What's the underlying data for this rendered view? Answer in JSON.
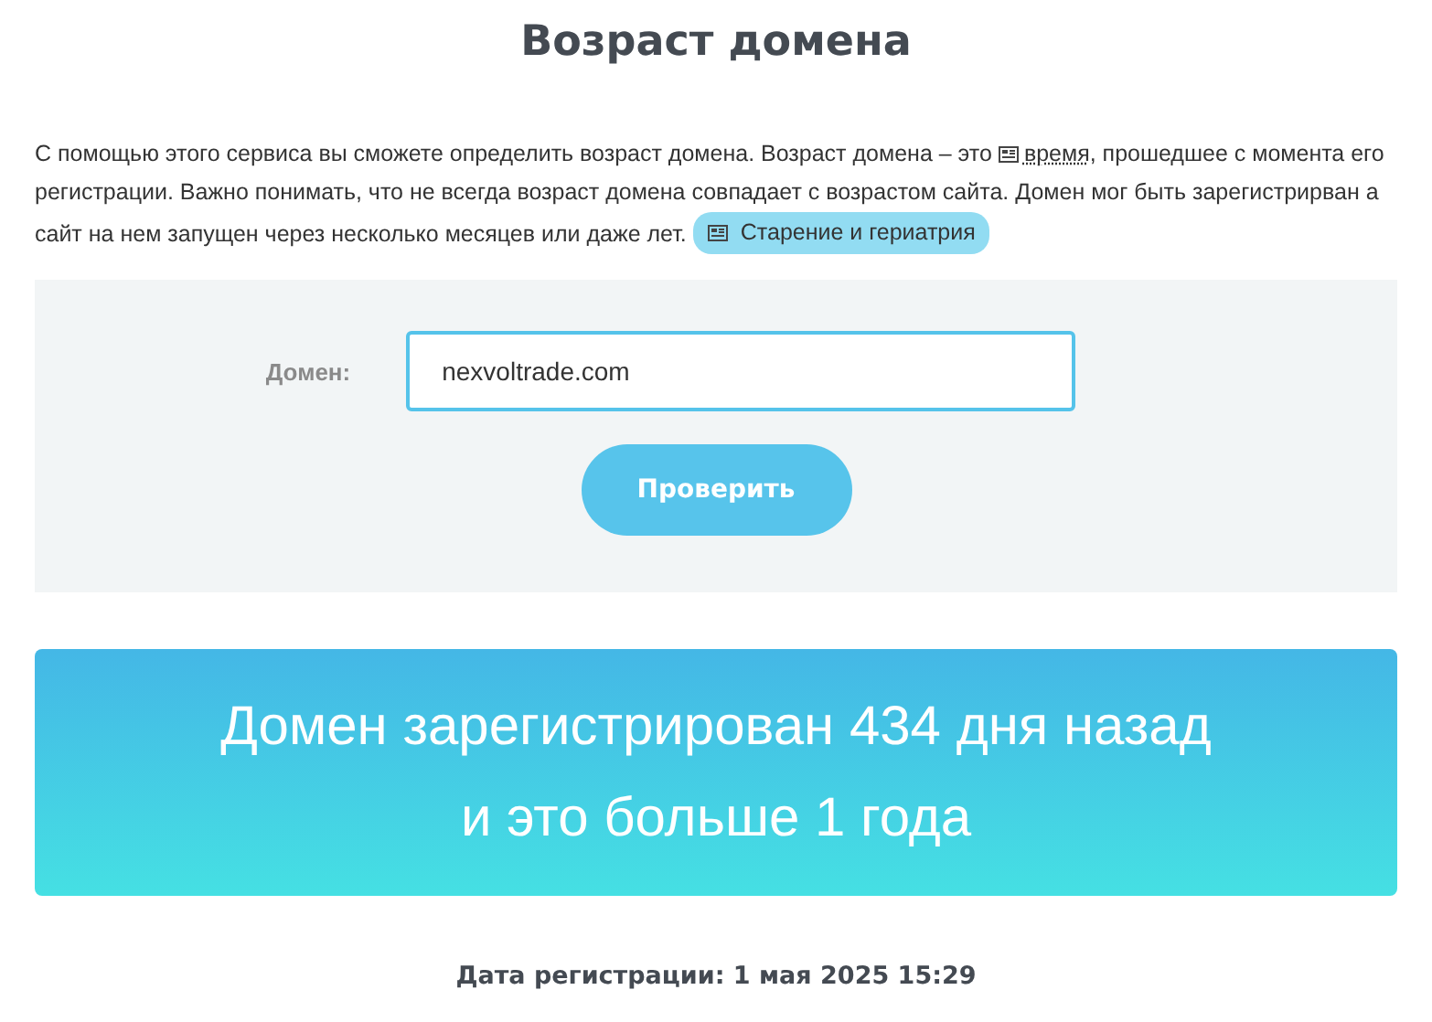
{
  "title": "Возраст домена",
  "intro": {
    "text_before": "С помощью этого сервиса вы сможете определить возраст домена. Возраст домена – это",
    "link": "время",
    "text_after": ", прошедшее с момента его регистрации. Важно понимать, что не всегда возраст домена совпадает с возрастом сайта. Домен мог быть зарегистрирван а сайт на нем запущен через несколько месяцев или даже лет.",
    "tag": "Старение и гериатрия"
  },
  "form": {
    "label": "Домен:",
    "value": "nexvoltrade.com",
    "button": "Проверить"
  },
  "result": {
    "lines": [
      "Домен зарегистрирован 434 дня назад",
      "и это больше 1 года"
    ]
  },
  "registration_date": "Дата регистрации: 1 мая 2025 15:29"
}
